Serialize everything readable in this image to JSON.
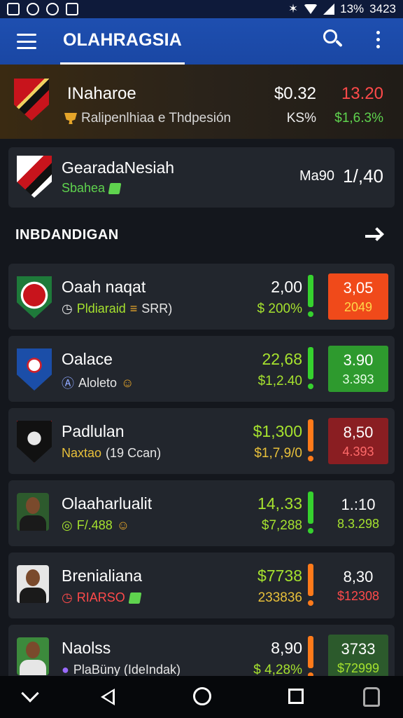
{
  "status_bar": {
    "icons": [
      "image-icon",
      "share-icon",
      "settings-icon",
      "app-icon",
      "bluetooth-icon",
      "wifi-icon",
      "signal-icon"
    ],
    "battery": "13%",
    "time": "3423"
  },
  "app_bar": {
    "title": "OLAHRAGSIA",
    "icons": [
      "menu-icon",
      "search-icon",
      "more-vert-icon"
    ],
    "accent": "#1e4fb0"
  },
  "featured": {
    "name": "INaharoe",
    "subtitle": "Ralipenlhiaa e Thdpesión",
    "price": "$0.32",
    "percent": "KS%",
    "odd": "13.20",
    "odd_change": "$1,6.3%"
  },
  "card2": {
    "name": "GearadaNesiah",
    "subtitle": "Sbahea",
    "value_label": "Ma90",
    "value": "1/,40"
  },
  "section": {
    "title": "INBDANDIGAN"
  },
  "list": [
    {
      "name": "Oaah naqat",
      "sub_a": "Pldiaraid",
      "sub_b": "SRR)",
      "p1": "2,00",
      "p2": "$ 200%",
      "p1_color": "#ffffff",
      "p2_color": "#a6e22e",
      "bar_color": "#36d12e",
      "box_top": "3,05",
      "box_bottom": "2049",
      "box_color": "#f04a1a",
      "box_bottom_color": "#ffd84a",
      "crest": "red-white"
    },
    {
      "name": "Oalace",
      "sub_a": "Aloleto",
      "sub_b": "",
      "p1": "22,68",
      "p2": "$1,2.40",
      "p1_color": "#a6e22e",
      "p2_color": "#a6e22e",
      "bar_color": "#36d12e",
      "box_top": "3.90",
      "box_bottom": "3.393",
      "box_color": "#2e9a2e",
      "box_bottom_color": "#e6ffe6",
      "crest": "blue"
    },
    {
      "name": "Padlulan",
      "sub_a": "Naxtao",
      "sub_b": "(19 Ccan)",
      "p1": "$1,300",
      "p2": "$1,7,9/0",
      "p1_color": "#a6e22e",
      "p2_color": "#e8c03a",
      "bar_color": "#ff7a1a",
      "box_top": "8,50",
      "box_bottom": "4.393",
      "box_color": "#8a1e22",
      "box_bottom_color": "#ff6a6a",
      "crest": "black"
    },
    {
      "name": "Olaaharlualit",
      "sub_a": "F/.488",
      "sub_b": "",
      "p1": "14,.33",
      "p2": "$7,288",
      "p1_color": "#a6e22e",
      "p2_color": "#a6e22e",
      "bar_color": "#36d12e",
      "box_top": "1.:10",
      "box_bottom": "8.3.298",
      "box_color": "#22262d",
      "box_bottom_color": "#a6e22e",
      "crest": "player"
    },
    {
      "name": "Brenialiana",
      "sub_a": "RIARSO",
      "sub_b": "",
      "p1": "$7738",
      "p2": "233836",
      "p1_color": "#a6e22e",
      "p2_color": "#e8c03a",
      "bar_color": "#ff7a1a",
      "box_top": "8,30",
      "box_bottom": "$12308",
      "box_color": "#22262d",
      "box_bottom_color": "#ff4a4a",
      "crest": "player"
    },
    {
      "name": "Naolss",
      "sub_a": "PlaBüny (IdeIndak)",
      "sub_b": "",
      "p1": "8,90",
      "p2": "$ 4,28%",
      "p1_color": "#ffffff",
      "p2_color": "#a6e22e",
      "bar_color": "#ff7a1a",
      "box_top": "3733",
      "box_bottom": "$72999",
      "box_color": "#2c5a2c",
      "box_bottom_color": "#a6e22e",
      "crest": "player"
    }
  ],
  "nav_bar": {
    "icons": [
      "collapse-icon",
      "back-icon",
      "home-icon",
      "recents-icon",
      "assistant-icon"
    ]
  }
}
